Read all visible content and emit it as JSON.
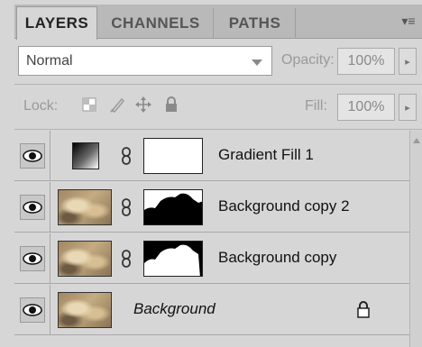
{
  "tabs": [
    {
      "label": "LAYERS",
      "active": true
    },
    {
      "label": "CHANNELS",
      "active": false
    },
    {
      "label": "PATHS",
      "active": false
    }
  ],
  "panel_menu_icon": "panel-menu-icon",
  "blend": {
    "mode": "Normal",
    "opacity_label": "Opacity:",
    "opacity_value": "100%"
  },
  "lock": {
    "label": "Lock:",
    "fill_label": "Fill:",
    "fill_value": "100%",
    "icons": [
      "lock-transparent-pixels-icon",
      "lock-image-pixels-icon",
      "lock-position-icon",
      "lock-all-icon"
    ]
  },
  "layers": [
    {
      "name": "Gradient Fill 1",
      "visible": true,
      "thumbnail": "gradient-swatch",
      "mask": "white"
    },
    {
      "name": "Background copy 2",
      "visible": true,
      "thumbnail": "photo",
      "mask": "silhouette-a"
    },
    {
      "name": "Background copy",
      "visible": true,
      "thumbnail": "photo",
      "mask": "silhouette-b"
    },
    {
      "name": "Background",
      "visible": true,
      "thumbnail": "photo",
      "locked": true
    }
  ],
  "colors": {
    "panel": "#d6d6d6",
    "tabbar": "#b9b9b9",
    "text": "#1a1a1a",
    "disabled": "#9a9a9a"
  }
}
